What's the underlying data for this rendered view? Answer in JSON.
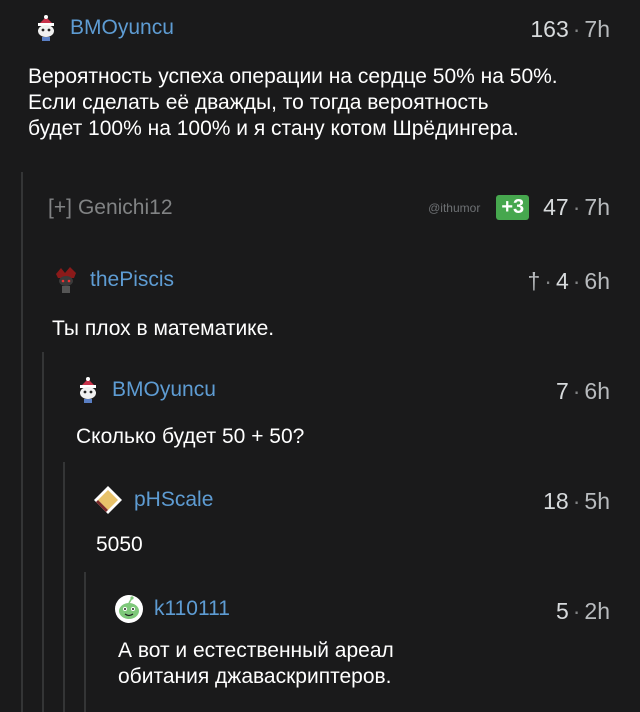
{
  "comments": [
    {
      "user": "BMOyuncu",
      "score": "163",
      "sep": "·",
      "time": "7h",
      "avatar_icon": "snoo-santa-hat-icon",
      "text_lines": [
        "Вероятность успеха операции на сердце 50% на 50%.",
        "Если сделать её дважды, то тогда вероятность",
        "будет 100% на 100% и я стану котом Шрёдингера."
      ]
    },
    {
      "collapse_toggle": "[+]",
      "user": "Genichi12",
      "watermark": "@ithumor",
      "badge": "+3",
      "score": "47",
      "sep": "·",
      "time": "7h"
    },
    {
      "user": "thePiscis",
      "prefix": "†",
      "score": "4",
      "sep": "·",
      "time": "6h",
      "avatar_icon": "dark-red-avatar-icon",
      "text_lines": [
        "Ты плох в математике."
      ]
    },
    {
      "user": "BMOyuncu",
      "score": "7",
      "sep": "·",
      "time": "6h",
      "avatar_icon": "snoo-santa-hat-icon",
      "text_lines": [
        "Сколько будет 50 + 50?"
      ]
    },
    {
      "user": "pHScale",
      "score": "18",
      "sep": "·",
      "time": "5h",
      "avatar_icon": "book-avatar-icon",
      "text_lines": [
        "5050"
      ]
    },
    {
      "user": "k110111",
      "score": "5",
      "sep": "·",
      "time": "2h",
      "avatar_icon": "green-snoo-icon",
      "text_lines": [
        "А вот и естественный ареал",
        "обитания джаваскриптеров."
      ]
    }
  ],
  "colors": {
    "background": "#1a1a1b",
    "username": "#5e9cd3",
    "badge": "#46a74e",
    "thread_line": "#343536"
  }
}
